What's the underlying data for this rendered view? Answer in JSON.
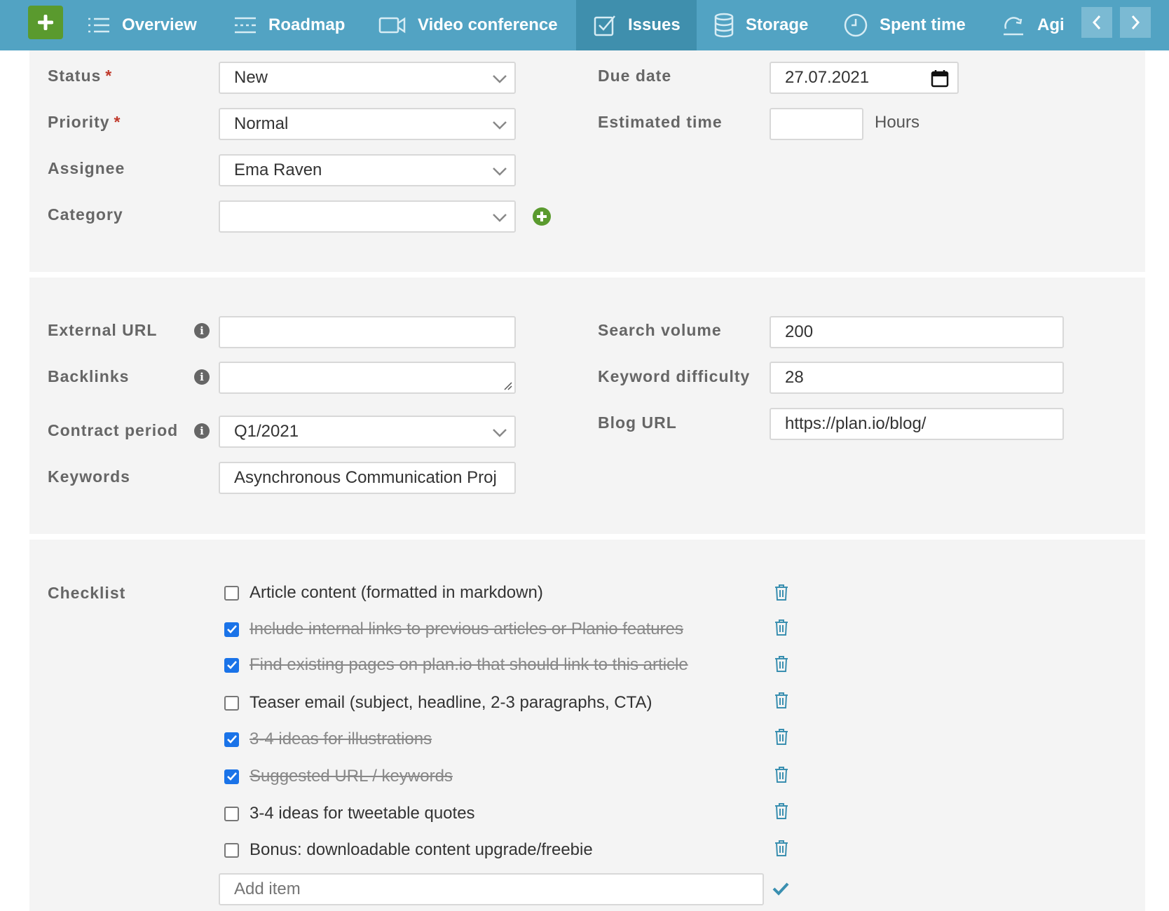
{
  "nav": {
    "new_button_icon": "plus-icon",
    "tabs": [
      {
        "label": "Overview",
        "icon": "list-icon",
        "active": false
      },
      {
        "label": "Roadmap",
        "icon": "roadmap-icon",
        "active": false
      },
      {
        "label": "Video conference",
        "icon": "video-camera-icon",
        "active": false
      },
      {
        "label": "Issues",
        "icon": "checkbox-icon",
        "active": true
      },
      {
        "label": "Storage",
        "icon": "database-icon",
        "active": false
      },
      {
        "label": "Spent time",
        "icon": "clock-icon",
        "active": false
      },
      {
        "label": "Agi",
        "icon": "refresh-icon",
        "active": false
      }
    ],
    "scroll_left_icon": "chevron-left-icon",
    "scroll_right_icon": "chevron-right-icon"
  },
  "attributes": {
    "status": {
      "label": "Status",
      "required_mark": "*",
      "value": "New"
    },
    "priority": {
      "label": "Priority",
      "required_mark": "*",
      "value": "Normal"
    },
    "assignee": {
      "label": "Assignee",
      "value": "Ema Raven"
    },
    "category": {
      "label": "Category",
      "value": ""
    },
    "due_date": {
      "label": "Due date",
      "value": "27.07.2021"
    },
    "estimated_time": {
      "label": "Estimated time",
      "value": "",
      "unit": "Hours"
    }
  },
  "custom_fields": {
    "external_url": {
      "label": "External URL",
      "value": ""
    },
    "backlinks": {
      "label": "Backlinks",
      "value": ""
    },
    "contract_period": {
      "label": "Contract period",
      "value": "Q1/2021"
    },
    "keywords": {
      "label": "Keywords",
      "value": "Asynchronous Communication Proj"
    },
    "search_volume": {
      "label": "Search volume",
      "value": "200"
    },
    "keyword_difficulty": {
      "label": "Keyword difficulty",
      "value": "28"
    },
    "blog_url": {
      "label": "Blog URL",
      "value": "https://plan.io/blog/"
    }
  },
  "checklist": {
    "label": "Checklist",
    "items": [
      {
        "text": "Article content (formatted in markdown)",
        "done": false
      },
      {
        "text": "Include internal links to previous articles or Planio features",
        "done": true
      },
      {
        "text": "Find existing pages on plan.io that should link to this article",
        "done": true
      },
      {
        "text": "Teaser email (subject, headline, 2-3 paragraphs, CTA)",
        "done": false
      },
      {
        "text": "3-4 ideas for illustrations",
        "done": true
      },
      {
        "text": "Suggested URL / keywords",
        "done": true
      },
      {
        "text": "3-4 ideas for tweetable quotes",
        "done": false
      },
      {
        "text": "Bonus: downloadable content upgrade/freebie",
        "done": false
      }
    ],
    "add_placeholder": "Add item"
  },
  "colors": {
    "nav_bg": "#52a3c3",
    "nav_active": "#3f8fad",
    "new_button": "#5a9a2e",
    "checkbox_checked": "#1a73e8",
    "trash_icon": "#3a8fb0"
  }
}
